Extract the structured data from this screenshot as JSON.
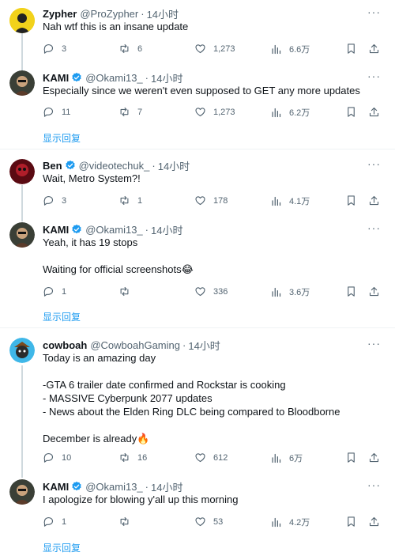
{
  "tweets": [
    {
      "name": "Zypher",
      "handle": "@ProZypher",
      "time": "14小时",
      "verified": false,
      "lines": [
        "Nah wtf this is an insane update"
      ],
      "replies": "3",
      "retweets": "6",
      "likes": "1,273",
      "views": "6.6万"
    },
    {
      "name": "KAMI",
      "handle": "@Okami13_",
      "time": "14小时",
      "verified": true,
      "lines": [
        "Especially since we weren't even supposed to GET any more updates"
      ],
      "replies": "11",
      "retweets": "7",
      "likes": "1,273",
      "views": "6.2万",
      "show_replies": "显示回复"
    },
    {
      "name": "Ben",
      "handle": "@videotechuk_",
      "time": "14小时",
      "verified": true,
      "lines": [
        "Wait, Metro System?!"
      ],
      "replies": "3",
      "retweets": "1",
      "likes": "178",
      "views": "4.1万"
    },
    {
      "name": "KAMI",
      "handle": "@Okami13_",
      "time": "14小时",
      "verified": true,
      "lines": [
        "Yeah, it has 19 stops",
        "",
        "Waiting for official screenshots😂"
      ],
      "replies": "1",
      "retweets": "",
      "likes": "336",
      "views": "3.6万",
      "show_replies": "显示回复"
    },
    {
      "name": "cowboah",
      "handle": "@CowboahGaming",
      "time": "14小时",
      "verified": false,
      "lines": [
        "Today is an amazing day",
        "",
        "-GTA 6 trailer date confirmed and Rockstar is cooking",
        "- MASSIVE Cyberpunk 2077 updates",
        "- News about the Elden Ring DLC being compared to Bloodborne",
        "",
        "December is  already🔥"
      ],
      "replies": "10",
      "retweets": "16",
      "likes": "612",
      "views": "6万"
    },
    {
      "name": "KAMI",
      "handle": "@Okami13_",
      "time": "14小时",
      "verified": true,
      "lines": [
        "I apologize for blowing y'all up this morning"
      ],
      "replies": "1",
      "retweets": "",
      "likes": "53",
      "views": "4.2万",
      "show_replies": "显示回复"
    }
  ],
  "ui": {
    "more": "···"
  },
  "colors": {
    "verified": "#1d9bf0",
    "link": "#1d9bf0",
    "muted": "#536471",
    "thread_line": "#cfd9de"
  },
  "icons": {
    "reply": "reply-icon",
    "retweet": "retweet-icon",
    "like": "heart-icon",
    "views": "views-icon",
    "bookmark": "bookmark-icon",
    "share": "share-icon",
    "more": "more-icon"
  }
}
